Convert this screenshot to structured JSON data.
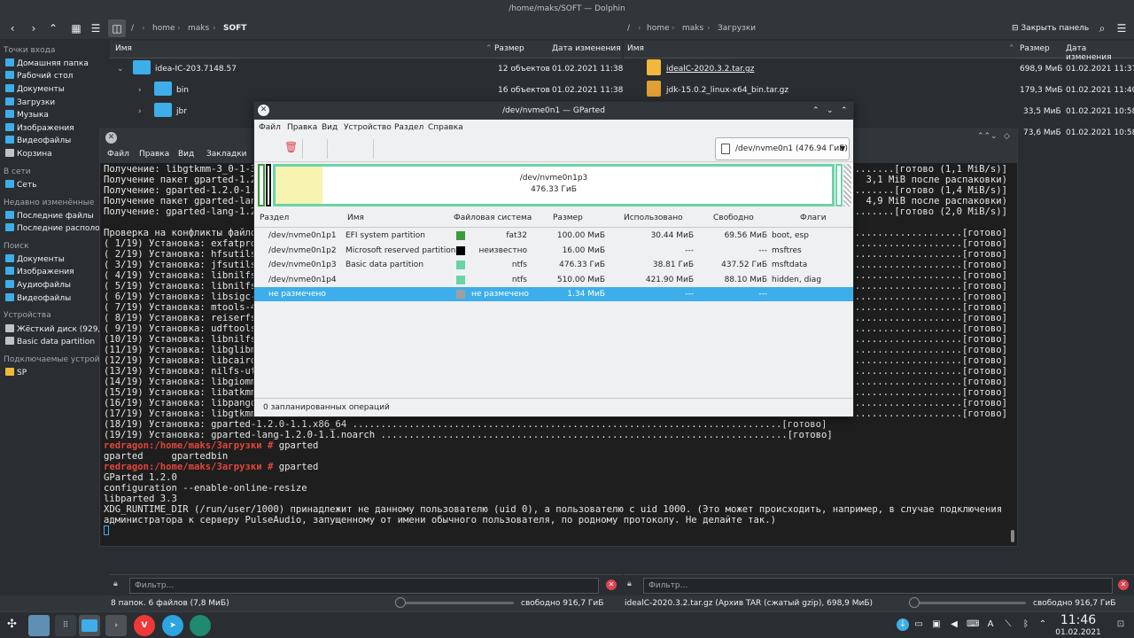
{
  "dolphin": {
    "title": "/home/maks/SOFT — Dolphin",
    "breadcrumb_left": [
      "/",
      "home",
      "maks",
      "SOFT"
    ],
    "breadcrumb_right": [
      "/",
      "home",
      "maks",
      "Загрузки"
    ],
    "close_panel": "Закрыть панель",
    "places": {
      "sections": [
        {
          "header": "Точки входа",
          "items": [
            "Домашняя папка",
            "Рабочий стол",
            "Документы",
            "Загрузки",
            "Музыка",
            "Изображения",
            "Видеофайлы",
            "Корзина"
          ]
        },
        {
          "header": "В сети",
          "items": [
            "Сеть"
          ]
        },
        {
          "header": "Недавно изменённые",
          "items": [
            "Последние файлы",
            "Последние располож"
          ]
        },
        {
          "header": "Поиск",
          "items": [
            "Документы",
            "Изображения",
            "Аудиофайлы",
            "Видеофайлы"
          ]
        },
        {
          "header": "Устройства",
          "items": [
            "Жёсткий диск (929,0 ГиБ)",
            "Basic data partition"
          ]
        },
        {
          "header": "Подключаемые устройства",
          "items": [
            "SP"
          ]
        }
      ]
    },
    "left_pane": {
      "columns": [
        "Имя",
        "Размер",
        "Дата изменения"
      ],
      "rows": [
        {
          "name": "idea-IC-203.7148.57",
          "size": "12 объектов",
          "date": "01.02.2021 11:38"
        },
        {
          "name": "bin",
          "size": "16 объектов",
          "date": "01.02.2021 11:38"
        },
        {
          "name": "jbr",
          "size": "",
          "date": ""
        }
      ]
    },
    "right_pane": {
      "columns": [
        "Имя",
        "Размер",
        "Дата изменения"
      ],
      "rows": [
        {
          "name": "idealC-2020.3.2.tar.gz",
          "size": "698,9 МиБ",
          "date": "01.02.2021 11:37"
        },
        {
          "name": "jdk-15.0.2_linux-x64_bin.tar.gz",
          "size": "179,3 МиБ",
          "date": "01.02.2021 11:40"
        },
        {
          "name": "",
          "size": "33,5 МиБ",
          "date": "01.02.2021 10:58"
        },
        {
          "name": "",
          "size": "73,6 МиБ",
          "date": "01.02.2021 10:58"
        }
      ]
    },
    "filter_placeholder": "Фильтр...",
    "status_left": "8 папок. 6 файлов (7,8 МиБ)",
    "free_left": "свободно 916,7 ГиБ",
    "status_right": "idealC-2020.3.2.tar.gz (Архив TAR (сжатый gzip), 698,9 МиБ)",
    "free_right": "свободно 916,7 ГиБ"
  },
  "terminal": {
    "menu": [
      "Файл",
      "Правка",
      "Вид",
      "Закладки"
    ],
    "lines": [
      {
        "t": "Получение: libgtkmm-3_0-1-3."
      },
      {
        "t": "Получение пакет gparted-1.2.0"
      },
      {
        "t": "Получение: gparted-1.2.0-1.1."
      },
      {
        "t": "Получение пакет gparted-lang"
      },
      {
        "t": "Получение: gparted-lang-1.2.0"
      },
      {
        "t": ""
      },
      {
        "t": "Проверка на конфликты файлов"
      },
      {
        "t": "( 1/19) Установка: exfatprog"
      },
      {
        "t": "( 2/19) Установка: hfsutils-"
      },
      {
        "t": "( 3/19) Установка: jfsutils-"
      },
      {
        "t": "( 4/19) Установка: libnilfs0"
      },
      {
        "t": "( 5/19) Установка: libnilfsc"
      },
      {
        "t": "( 6/19) Установка: libsigc-2"
      },
      {
        "t": "( 7/19) Установка: mtools-4."
      },
      {
        "t": "( 8/19) Установка: reiserfs-"
      },
      {
        "t": "( 9/19) Установка: udftools-"
      },
      {
        "t": "(10/19) Установка: libnilfsge"
      },
      {
        "t": "(11/19) Установка: libglibmm-"
      },
      {
        "t": "(12/19) Установка: libcairomm"
      },
      {
        "t": "(13/19) Установка: nilfs-util"
      },
      {
        "t": "(14/19) Установка: libgiomm-"
      },
      {
        "t": "(15/19) Установка: libatkmm-"
      },
      {
        "t": "(16/19) Установка: libpangom"
      },
      {
        "t": "(17/19) Установка: libgtkmm-"
      },
      {
        "t": "(18/19) Установка: gparted-1.2.0-1.1.x86_64 ............................................................................[готово]"
      },
      {
        "t": "(19/19) Установка: gparted-lang-1.2.0-1.1.noarch ........................................................................[готово]"
      }
    ],
    "right_fragments": [
      ".........[готово (1,1 MiB/s)]",
      "(  3,1 MiB после распаковки)",
      ".........[готово (1,4 MiB/s)]",
      "(  4,9 MiB после распаковки)",
      ".........[готово (2,0 MiB/s)]",
      "",
      "......................[готово]",
      "......................[готово]",
      "......................[готово]",
      "......................[готово]",
      "......................[готово]",
      "......................[готово]",
      "......................[готово]",
      "......................[готово]",
      "......................[готово]",
      "......................[готово]",
      "......................[готово]",
      "......................[готово]",
      "......................[готово]",
      "......................[готово]",
      "......................[готово]",
      "......................[готово]",
      "......................[готово]",
      "......................[готово]"
    ],
    "tail": [
      {
        "prompt": "redragon:/home/maks/Загрузки # ",
        "cmd": "gparted"
      },
      {
        "t": "gparted     gpartedbin"
      },
      {
        "prompt": "redragon:/home/maks/Загрузки # ",
        "cmd": "gparted"
      },
      {
        "t": "GParted 1.2.0"
      },
      {
        "t": "configuration --enable-online-resize"
      },
      {
        "t": "libparted 3.3"
      },
      {
        "t": "XDG_RUNTIME_DIR (/run/user/1000) принадлежит не данному пользователю (uid 0), а пользователю с uid 1000. (Это может происходить, например, в случае подключения от имени"
      },
      {
        "t": "администратора к серверу PulseAudio, запущенному от имени обычного пользователя, по родному протоколу. Не делайте так.)"
      }
    ]
  },
  "gparted": {
    "title": "/dev/nvme0n1 — GParted",
    "menu": [
      "Файл",
      "Правка",
      "Вид",
      "Устройство",
      "Раздел",
      "Справка"
    ],
    "device": "/dev/nvme0n1 (476.94 ГиБ)",
    "map_label": "/dev/nvme0n1p3",
    "map_size": "476.33 ГиБ",
    "columns": [
      "Раздел",
      "Имя",
      "Файловая система",
      "Размер",
      "Использовано",
      "Свободно",
      "Флаги"
    ],
    "rows": [
      {
        "part": "/dev/nvme0n1p1",
        "name": "EFI system partition",
        "fs": "fat32",
        "color": "#3c9b3c",
        "size": "100.00 МиБ",
        "used": "30.44 МиБ",
        "free": "69.56 МиБ",
        "flags": "boot, esp"
      },
      {
        "part": "/dev/nvme0n1p2",
        "name": "Microsoft reserved partition",
        "fs": "неизвестно",
        "color": "#000000",
        "size": "16.00 МиБ",
        "used": "---",
        "free": "---",
        "flags": "msftres"
      },
      {
        "part": "/dev/nvme0n1p3",
        "name": "Basic data partition",
        "fs": "ntfs",
        "color": "#6bd3a8",
        "size": "476.33 ГиБ",
        "used": "38.81 ГиБ",
        "free": "437.52 ГиБ",
        "flags": "msftdata"
      },
      {
        "part": "/dev/nvme0n1p4",
        "name": "",
        "fs": "ntfs",
        "color": "#6bd3a8",
        "size": "510.00 МиБ",
        "used": "421.90 МиБ",
        "free": "88.10 МиБ",
        "flags": "hidden, diag"
      },
      {
        "part": "не размечено",
        "name": "",
        "fs": "не размечено",
        "color": "#a0a0a0",
        "size": "1.34 МиБ",
        "used": "---",
        "free": "---",
        "flags": ""
      }
    ],
    "status": "0 запланированных операций"
  },
  "taskbar": {
    "time": "11:46",
    "date": "01.02.2021"
  }
}
